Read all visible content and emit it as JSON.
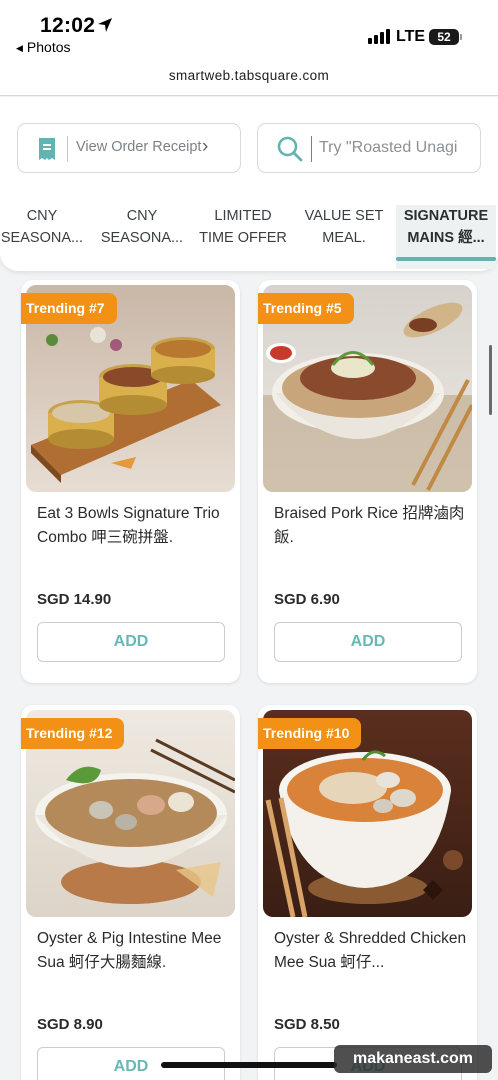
{
  "status_bar": {
    "time": "12:02",
    "back_app": "Photos",
    "network": "LTE",
    "battery": "52"
  },
  "browser": {
    "url": "smartweb.tabsquare.com"
  },
  "header": {
    "receipt_label": "View Order Receipt",
    "search_placeholder": "Try \"Roasted Unagi"
  },
  "tabs": [
    {
      "line1": "CNY",
      "line2": "SEASONA...",
      "active": false
    },
    {
      "line1": "CNY",
      "line2": "SEASONA...",
      "active": false
    },
    {
      "line1": "LIMITED",
      "line2": "TIME OFFER",
      "active": false
    },
    {
      "line1": "VALUE SET",
      "line2": "MEAL.",
      "active": false
    },
    {
      "line1": "SIGNATURE",
      "line2": "MAINS 經...",
      "active": true
    }
  ],
  "products": [
    {
      "badge": "Trending #7",
      "name": "Eat 3 Bowls Signature Trio Combo 呷三碗拼盤.",
      "price": "SGD 14.90",
      "add_label": "ADD"
    },
    {
      "badge": "Trending #5",
      "name": "Braised Pork Rice 招牌滷肉飯.",
      "price": "SGD 6.90",
      "add_label": "ADD"
    },
    {
      "badge": "Trending #12",
      "name": "Oyster & Pig Intestine Mee Sua 蚵仔大腸麵線.",
      "price": "SGD 8.90",
      "add_label": "ADD"
    },
    {
      "badge": "Trending #10",
      "name": "Oyster & Shredded Chicken Mee Sua 蚵仔...",
      "price": "SGD 8.50",
      "add_label": "ADD"
    }
  ],
  "watermark": "makaneast.com",
  "colors": {
    "accent_teal": "#62b4b1",
    "badge_orange": "#f39016"
  },
  "icons": [
    "location-arrow-icon",
    "receipt-icon",
    "chevron-right-icon",
    "search-icon"
  ]
}
